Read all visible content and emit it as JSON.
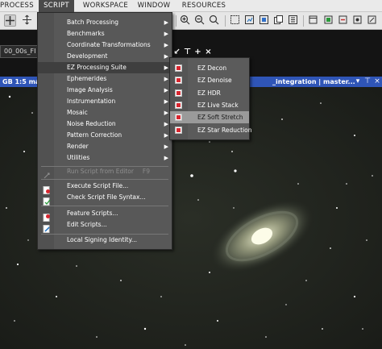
{
  "menubar": {
    "items": [
      "PROCESS",
      "SCRIPT",
      "WORKSPACE",
      "WINDOW",
      "RESOURCES"
    ],
    "active": "SCRIPT"
  },
  "toolbar": {
    "icons": [
      "add-icon",
      "move-icon",
      "zoom-in-icon",
      "zoom-out-icon",
      "zoom-fit-icon",
      "preview-icon",
      "readout-icon",
      "color-sample-icon",
      "copy-icon",
      "info-icon",
      "window-icon",
      "history-icon"
    ]
  },
  "workspace": {
    "sub_window_tab": "00_00s_FI",
    "image_title": "GB 1:5 mas",
    "image_title_right": "_integration | master...",
    "accent_titlebar": "#2f55b7"
  },
  "script_menu": {
    "items": [
      {
        "label": "Batch Processing",
        "submenu": true
      },
      {
        "label": "Benchmarks",
        "submenu": true
      },
      {
        "label": "Coordinate Transformations",
        "submenu": true
      },
      {
        "label": "Development",
        "submenu": true
      },
      {
        "label": "EZ Processing Suite",
        "submenu": true,
        "active": true
      },
      {
        "label": "Ephemerides",
        "submenu": true
      },
      {
        "label": "Image Analysis",
        "submenu": true
      },
      {
        "label": "Instrumentation",
        "submenu": true
      },
      {
        "label": "Mosaic",
        "submenu": true
      },
      {
        "label": "Noise Reduction",
        "submenu": true
      },
      {
        "label": "Pattern Correction",
        "submenu": true
      },
      {
        "label": "Render",
        "submenu": true
      },
      {
        "label": "Utilities",
        "submenu": true
      }
    ],
    "run_script": {
      "label": "Run Script from Editor",
      "shortcut": "F9",
      "disabled": true
    },
    "execute": "Execute Script File...",
    "check_syntax": "Check Script File Syntax...",
    "feature_scripts": "Feature Scripts...",
    "edit_scripts": "Edit Scripts...",
    "signing": "Local Signing Identity..."
  },
  "ez_submenu": {
    "items": [
      "EZ Decon",
      "EZ Denoise",
      "EZ HDR",
      "EZ Live Stack",
      "EZ Soft Stretch",
      "EZ Star Reduction"
    ],
    "active": "EZ Soft Stretch",
    "icon_color": "#d8262f"
  }
}
